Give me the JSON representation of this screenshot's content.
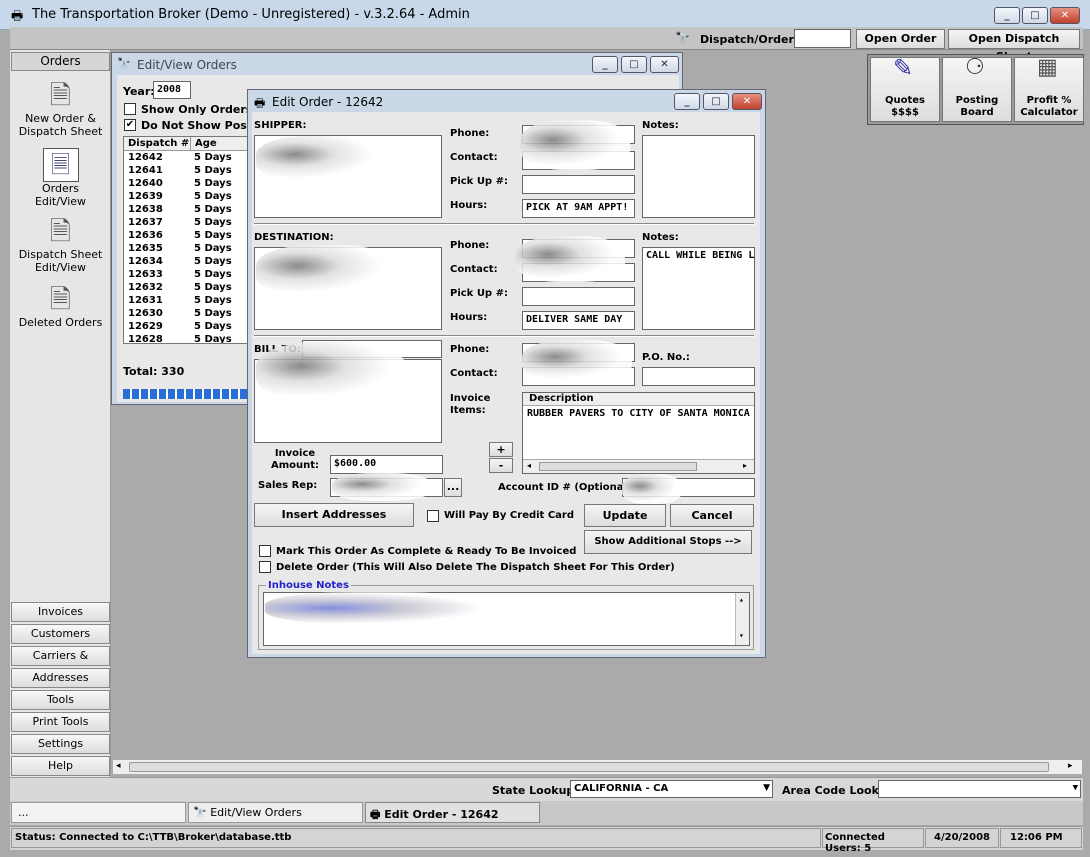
{
  "app": {
    "title": "The Transportation Broker (Demo - Unregistered) - v.3.2.64 - Admin"
  },
  "topbar": {
    "dispatch_label": "Dispatch/Order #:",
    "dispatch_value": "",
    "open_order": "Open Order",
    "open_dispatch": "Open Dispatch Sheet"
  },
  "tools": [
    {
      "line1": "Quotes",
      "line2": "$$$$"
    },
    {
      "line1": "Posting",
      "line2": "Board"
    },
    {
      "line1": "Profit %",
      "line2": "Calculator"
    }
  ],
  "sidebar": {
    "header": "Orders",
    "items": [
      {
        "line1": "New Order &",
        "line2": "Dispatch Sheet"
      },
      {
        "line1": "Orders",
        "line2": "Edit/View"
      },
      {
        "line1": "Dispatch Sheet",
        "line2": "Edit/View"
      },
      {
        "line1": "Deleted Orders",
        "line2": ""
      }
    ],
    "bottom": [
      "Invoices",
      "Customers",
      "Carriers & Factors",
      "Addresses",
      "Tools",
      "Print Tools",
      "Settings",
      "Help"
    ]
  },
  "editview": {
    "title": "Edit/View Orders",
    "year_label": "Year:",
    "year": "2008",
    "show_only": "Show Only Orders Cre",
    "dont_show": "Do Not Show Posted C",
    "cols": [
      "Dispatch #",
      "Age"
    ],
    "rows": [
      [
        "12642",
        "5 Days"
      ],
      [
        "12641",
        "5 Days"
      ],
      [
        "12640",
        "5 Days"
      ],
      [
        "12639",
        "5 Days"
      ],
      [
        "12638",
        "5 Days"
      ],
      [
        "12637",
        "5 Days"
      ],
      [
        "12636",
        "5 Days"
      ],
      [
        "12635",
        "5 Days"
      ],
      [
        "12634",
        "5 Days"
      ],
      [
        "12633",
        "5 Days"
      ],
      [
        "12632",
        "5 Days"
      ],
      [
        "12631",
        "5 Days"
      ],
      [
        "12630",
        "5 Days"
      ],
      [
        "12629",
        "5 Days"
      ],
      [
        "12628",
        "5 Days"
      ]
    ],
    "total": "Total: 330"
  },
  "editorder": {
    "title": "Edit Order - 12642",
    "shipper": "SHIPPER:",
    "destination": "DESTINATION:",
    "billto": "BILL TO:",
    "phone": "Phone:",
    "contact": "Contact:",
    "pickup": "Pick Up #:",
    "hours": "Hours:",
    "notes": "Notes:",
    "po": "P.O. No.:",
    "ship_hours": "PICK AT 9AM APPT!",
    "dest_hours": "DELIVER SAME DAY",
    "dest_notes": "CALL WHILE BEING L",
    "invoice_items": "Invoice Items:",
    "desc_header": "Description",
    "desc_value": "RUBBER PAVERS  TO CITY OF SANTA MONICA",
    "plus": "+",
    "minus": "-",
    "invoice_amount_label": "Invoice Amount:",
    "invoice_amount": "$600.00",
    "salesrep": "Sales Rep:",
    "dots": "...",
    "account_id": "Account ID # (Optional)",
    "insert": "Insert Addresses",
    "credit": "Will Pay By Credit Card",
    "update": "Update",
    "cancel": "Cancel",
    "complete": "Mark This Order As Complete & Ready To Be Invoiced",
    "delete": "Delete Order (This Will Also Delete The Dispatch Sheet For This Order)",
    "show_stops": "Show Additional Stops -->",
    "inhouse": "Inhouse Notes"
  },
  "lookup": {
    "state_label": "State Lookup:",
    "state_value": "CALIFORNIA - CA",
    "area_label": "Area Code Lookup:",
    "area_value": ""
  },
  "taskbar": {
    "dots": "...",
    "editview": "Edit/View Orders",
    "editorder": "Edit Order - 12642"
  },
  "status": {
    "text": "Status: Connected to C:\\TTB\\Broker\\database.ttb",
    "users": "Connected Users: 5",
    "date": "4/20/2008",
    "time": "12:06 PM"
  }
}
